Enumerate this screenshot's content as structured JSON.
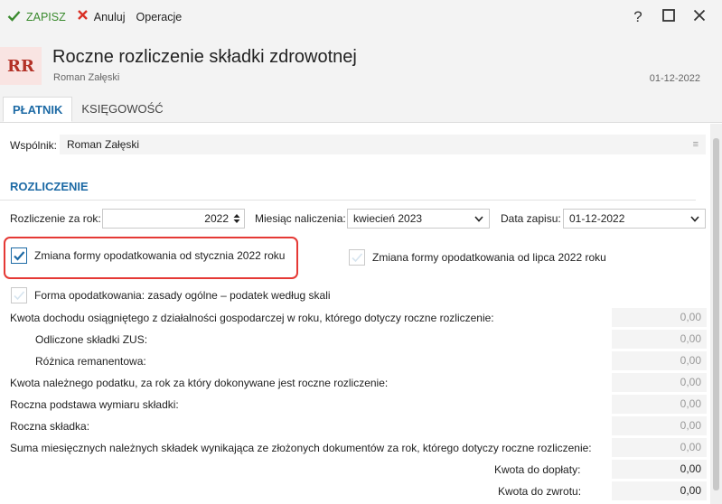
{
  "toolbar": {
    "save_label": "ZAPISZ",
    "cancel_label": "Anuluj",
    "operations_label": "Operacje"
  },
  "window": {
    "help": "?",
    "maximize": "☐",
    "close": "✕"
  },
  "header": {
    "avatar": "RR",
    "title": "Roczne rozliczenie składki zdrowotnej",
    "subtitle": "Roman Załęski",
    "date": "01-12-2022"
  },
  "tabs": [
    {
      "label": "PŁATNIK",
      "active": true
    },
    {
      "label": "KSIĘGOWOŚĆ",
      "active": false
    }
  ],
  "partner": {
    "label": "Wspólnik:",
    "value": "Roman Załęski"
  },
  "section": {
    "title": "ROZLICZENIE"
  },
  "settlement": {
    "year_label": "Rozliczenie za rok:",
    "year_value": "2022",
    "month_label": "Miesiąc naliczenia:",
    "month_value": "kwiecień 2023",
    "save_date_label": "Data zapisu:",
    "save_date_value": "01-12-2022"
  },
  "checkboxes": {
    "change_jan": {
      "label": "Zmiana formy opodatkowania od stycznia 2022 roku",
      "checked": true
    },
    "change_jul": {
      "label": "Zmiana formy opodatkowania od lipca 2022 roku",
      "checked": false
    },
    "tax_form": {
      "label": "Forma opodatkowania: zasady ogólne – podatek według skali",
      "checked": false
    }
  },
  "rows": [
    {
      "label": "Kwota dochodu osiągniętego z działalności gospodarczej w roku, którego dotyczy roczne rozliczenie:",
      "value": "0,00"
    },
    {
      "label": "Odliczone składki ZUS:",
      "value": "0,00"
    },
    {
      "label": "Różnica remanentowa:",
      "value": "0,00"
    },
    {
      "label": "Kwota należnego podatku, za rok za który dokonywane jest roczne rozliczenie:",
      "value": "0,00"
    },
    {
      "label": "Roczna podstawa wymiaru składki:",
      "value": "0,00"
    },
    {
      "label": "Roczna składka:",
      "value": "0,00"
    },
    {
      "label": "Suma miesięcznych należnych składek wynikająca ze złożonych dokumentów za rok, którego dotyczy roczne rozliczenie:",
      "value": "0,00"
    },
    {
      "label": "Kwota do dopłaty:",
      "value": "0,00"
    },
    {
      "label": "Kwota do zwrotu:",
      "value": "0,00"
    }
  ],
  "colors": {
    "accent": "#1d6aa5",
    "save": "#3a8a2e",
    "cancel": "#d93025",
    "highlight": "#e53935",
    "avatar_text": "#b33126"
  }
}
